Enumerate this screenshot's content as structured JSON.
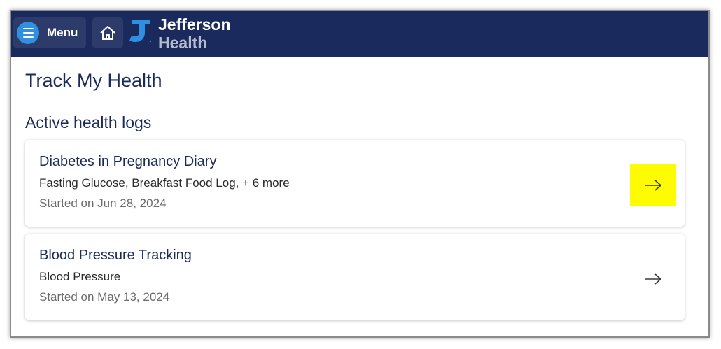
{
  "header": {
    "menu_label": "Menu",
    "logo_line1": "Jefferson",
    "logo_line2": "Health",
    "colors": {
      "bar": "#1b2a5c",
      "menu_circle": "#2f8fe0"
    }
  },
  "page": {
    "title": "Track My Health",
    "section_title": "Active health logs"
  },
  "logs": [
    {
      "name": "Diabetes in Pregnancy Diary",
      "items": "Fasting Glucose, Breakfast Food Log, + 6 more",
      "started": "Started on Jun 28, 2024",
      "arrow_highlight": "#fffb00"
    },
    {
      "name": "Blood Pressure Tracking",
      "items": "Blood Pressure",
      "started": "Started on May 13, 2024"
    }
  ],
  "icons": [
    "hamburger-icon",
    "home-icon",
    "jefferson-logo-icon",
    "arrow-right-icon"
  ]
}
